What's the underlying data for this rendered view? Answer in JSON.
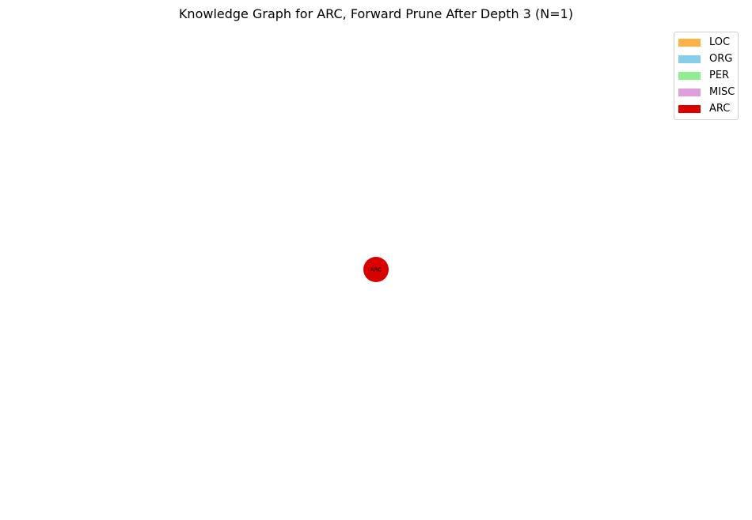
{
  "title": "Knowledge Graph for ARC, Forward Prune After Depth 3 (N=1)",
  "graph": {
    "nodes": [
      {
        "label": "ARC",
        "category": "ARC",
        "color": "#d90000"
      }
    ],
    "edges": []
  },
  "legend": {
    "items": [
      {
        "label": "LOC",
        "color": "#ffb347"
      },
      {
        "label": "ORG",
        "color": "#87ceeb"
      },
      {
        "label": "PER",
        "color": "#90ee90"
      },
      {
        "label": "MISC",
        "color": "#dda0dd"
      },
      {
        "label": "ARC",
        "color": "#d90000"
      }
    ]
  }
}
